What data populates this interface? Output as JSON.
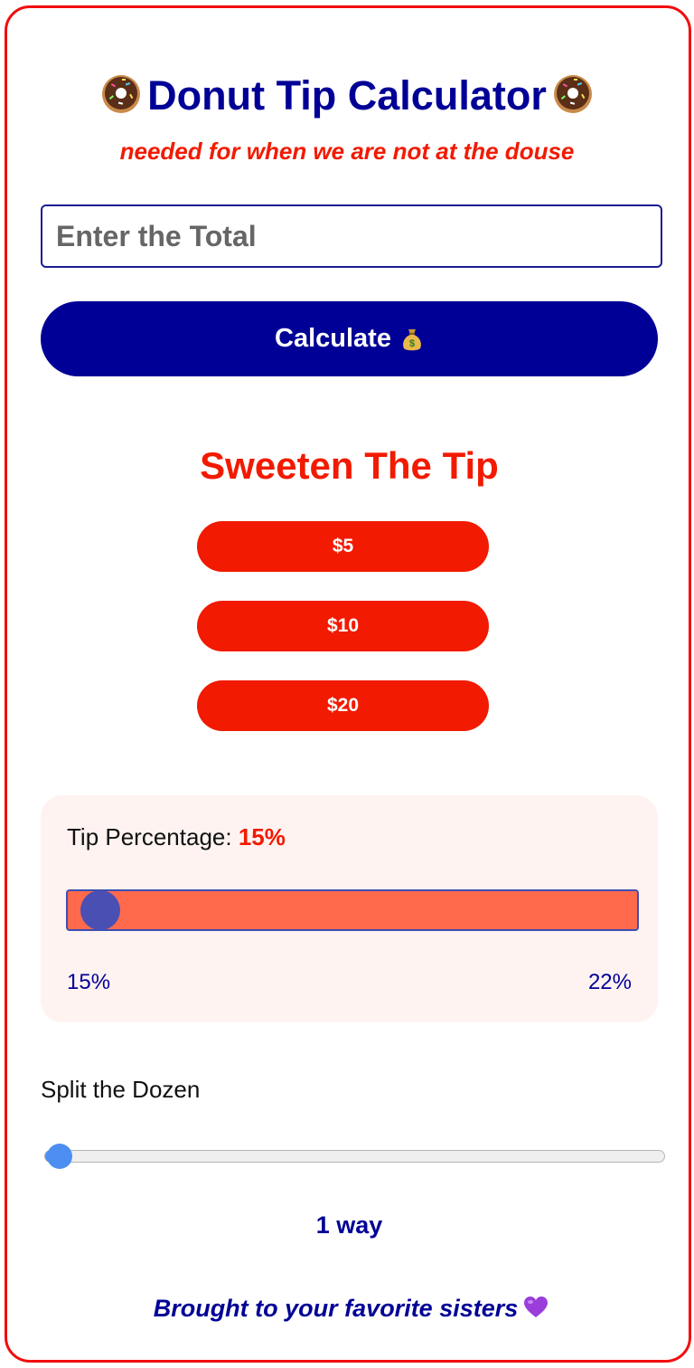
{
  "header": {
    "title": "Donut Tip Calculator",
    "subtitle": "needed for when we are not at the douse"
  },
  "total_input": {
    "placeholder": "Enter the Total",
    "value": ""
  },
  "calculate_button": {
    "label": "Calculate",
    "icon": "money-bag-icon"
  },
  "sweeten": {
    "heading": "Sweeten The Tip",
    "buttons": [
      "$5",
      "$10",
      "$20"
    ]
  },
  "tip_percentage": {
    "label": "Tip Percentage:",
    "value_text": "15%",
    "min_label": "15%",
    "max_label": "22%",
    "value": 15,
    "min": 15,
    "max": 22
  },
  "split": {
    "label": "Split the Dozen",
    "value_text": "1 way",
    "value": 1,
    "min": 1,
    "max": 12
  },
  "footer": {
    "text": "Brought to your favorite sisters",
    "icon": "purple-heart-icon"
  },
  "colors": {
    "frame_border": "#f20d0d",
    "primary_blue": "#000096",
    "accent_red": "#f21a00",
    "tip_track": "#ff6a4d",
    "panel_bg": "#fff3f1",
    "split_blue": "#4d8ef2"
  }
}
